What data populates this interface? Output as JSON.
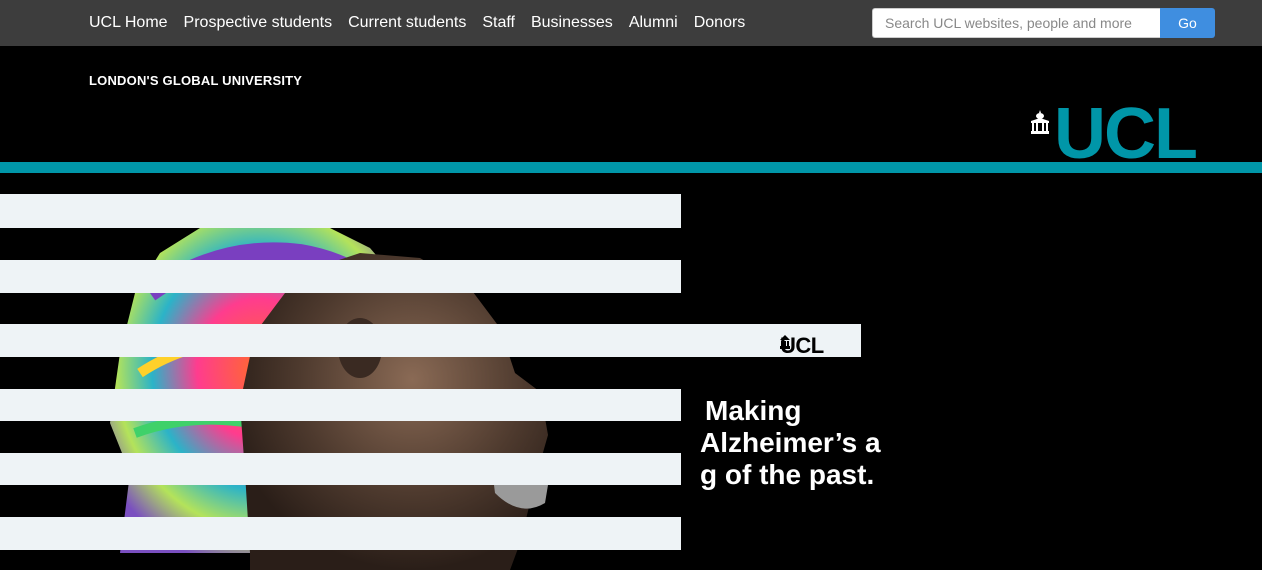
{
  "nav": {
    "items": [
      {
        "label": "UCL Home"
      },
      {
        "label": "Prospective students"
      },
      {
        "label": "Current students"
      },
      {
        "label": "Staff"
      },
      {
        "label": "Businesses"
      },
      {
        "label": "Alumni"
      },
      {
        "label": "Donors"
      }
    ]
  },
  "search": {
    "placeholder": "Search UCL websites, people and more",
    "button_label": "Go"
  },
  "header": {
    "tagline": "LONDON'S GLOBAL UNIVERSITY",
    "logo_text": "UCL"
  },
  "hero": {
    "logo_text": "UCL",
    "headline_lines": [
      "Making",
      "Alzheimer’s a",
      "g of the past."
    ]
  },
  "colors": {
    "brand_teal": "#0096a8",
    "topbar": "#3d3d3d",
    "button_blue": "#3f8ee0"
  }
}
